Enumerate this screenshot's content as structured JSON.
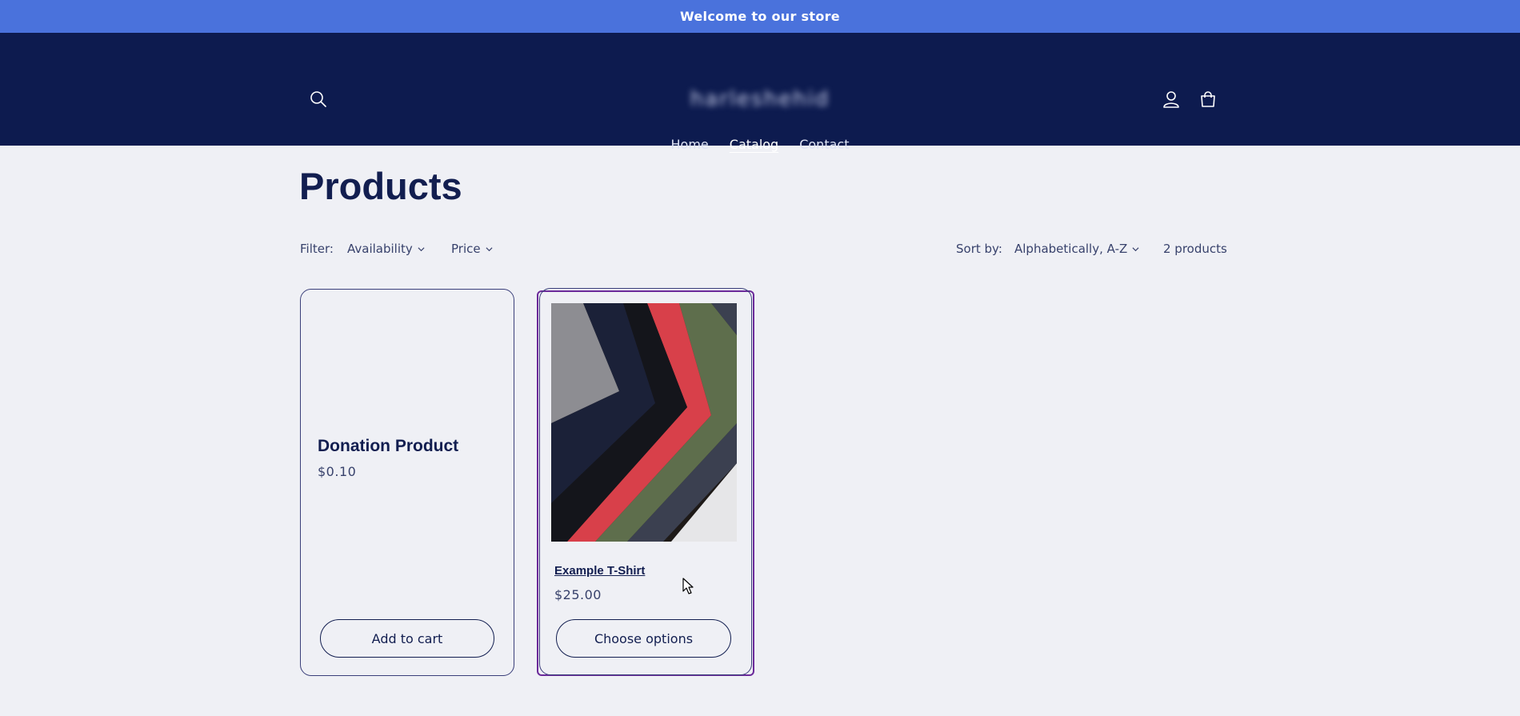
{
  "announcement": {
    "text": "Welcome to our store"
  },
  "header": {
    "logo_text": "harleshehid",
    "nav": [
      {
        "label": "Home",
        "active": false
      },
      {
        "label": "Catalog",
        "active": true
      },
      {
        "label": "Contact",
        "active": false
      }
    ],
    "icons": {
      "search": "search-icon",
      "account": "account-icon",
      "cart": "cart-icon"
    }
  },
  "main": {
    "title": "Products",
    "filter": {
      "label": "Filter:",
      "availability_label": "Availability",
      "price_label": "Price"
    },
    "sort": {
      "label": "Sort by:",
      "selected": "Alphabetically, A-Z"
    },
    "product_count": "2 products",
    "products": [
      {
        "name": "Donation Product",
        "price": "$0.10",
        "button": "Add to cart"
      },
      {
        "name": "Example T-Shirt",
        "price": "$25.00",
        "button": "Choose options"
      }
    ]
  },
  "colors": {
    "announcement_bg": "#4a72dc",
    "header_bg": "#0d1b4f",
    "page_bg": "#eff0f5",
    "text": "#121e50"
  }
}
